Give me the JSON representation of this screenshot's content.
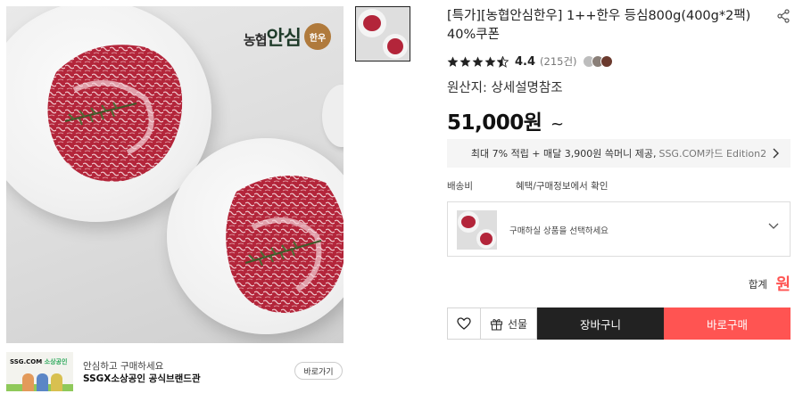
{
  "product": {
    "title": "[특가][농협안심한우] 1++한우 등심800g(400g*2팩) 40%쿠폰",
    "rating": {
      "stars": 4.5,
      "score": "4.4",
      "review_count": "(215건)"
    },
    "origin": "원산지: 상세설명참조",
    "price": "51,000원",
    "price_suffix": "~",
    "image_logo": {
      "prefix": "농협",
      "big": "안심",
      "seal": "한우"
    }
  },
  "card_banner": {
    "main": "최대 7% 적립 + 매달 3,900원 쓱머니 제공,",
    "grey": "SSG.COM카드 Edition2"
  },
  "shipping": {
    "label": "배송비",
    "value": "혜택/구매정보에서 확인"
  },
  "option": {
    "placeholder": "구매하실 상품을 선택하세요"
  },
  "total": {
    "label": "합계",
    "value": "원"
  },
  "actions": {
    "gift_label": "선물",
    "cart_label": "장바구니",
    "buy_label": "바로구매"
  },
  "store": {
    "logo_text": "SSG.COM",
    "logo_sub": "소상공인",
    "subtitle": "안심하고 구매하세요",
    "name": "SSGX소상공인 공식브랜드관",
    "button": "바로가기"
  },
  "colors": {
    "accent_red": "#ff5452",
    "dark": "#222222",
    "banner_bg": "#f5f5f5"
  },
  "icons": [
    "share-icon",
    "star-icon",
    "chevron-right-icon",
    "chevron-down-icon",
    "heart-icon",
    "gift-icon"
  ]
}
